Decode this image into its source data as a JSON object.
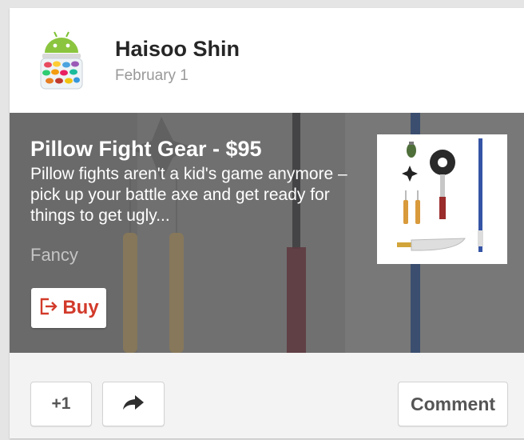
{
  "post": {
    "author": "Haisoo Shin",
    "date": "February 1",
    "avatar_icon": "android-jellybean-icon"
  },
  "link_card": {
    "title": "Pillow Fight Gear - $95",
    "description": "Pillow fights aren't a kid's game anymore – pick up your battle axe and get ready for things to get ugly...",
    "source": "Fancy",
    "buy_label": "Buy",
    "buy_icon": "buy-arrow-icon",
    "buy_color": "#d23a2a"
  },
  "actions": {
    "plus_one_label": "+1",
    "share_icon": "share-arrow-icon",
    "comment_label": "Comment"
  }
}
